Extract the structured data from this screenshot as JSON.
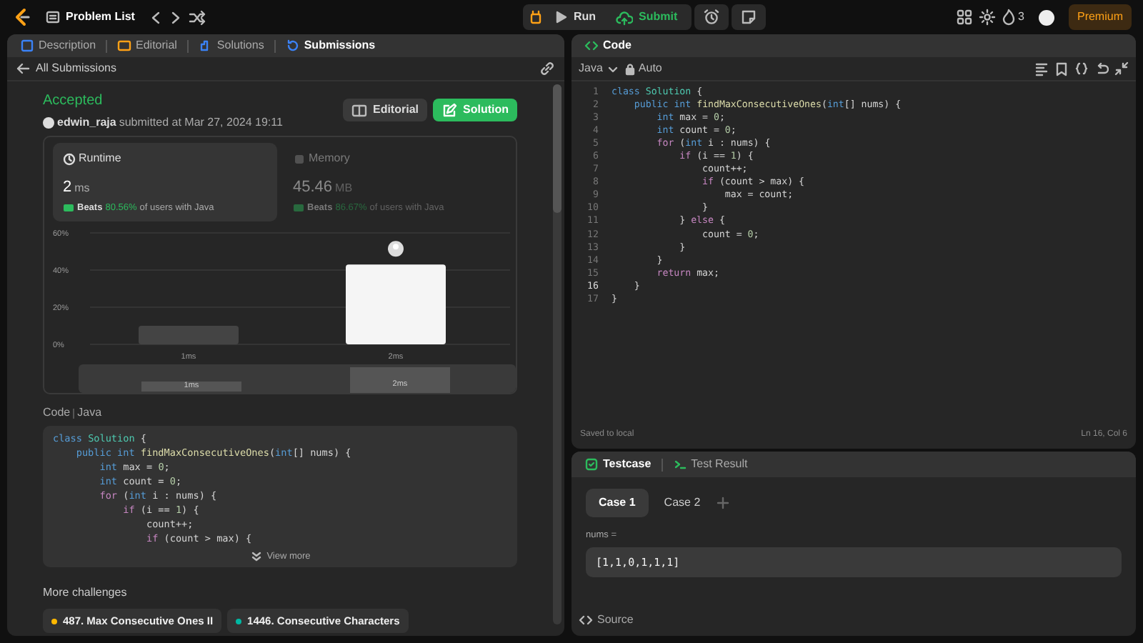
{
  "top_bar": {
    "title": "Problem List",
    "run": "Run",
    "submit": "Submit",
    "streak": "3",
    "premium": "Premium"
  },
  "left_panel": {
    "tabs": [
      {
        "label": "Description",
        "selected": false
      },
      {
        "label": "Editorial",
        "selected": false
      },
      {
        "label": "Solutions",
        "selected": false
      },
      {
        "label": "Submissions",
        "selected": true
      }
    ],
    "back_link": "All Submissions",
    "status": "Accepted",
    "user": "edwin_raja",
    "submitted": "submitted at Mar 27, 2024 19:11",
    "buttons": [
      {
        "label": "Editorial",
        "kind": "secondary"
      },
      {
        "label": "Solution",
        "kind": "primary"
      }
    ],
    "stats": [
      {
        "label": "Runtime",
        "value": "2",
        "unit": "ms",
        "beats_label": "Beats",
        "beats": "80.56%",
        "suffix": "of users with Java",
        "selected": true
      },
      {
        "label": "Memory",
        "value": "45.46",
        "unit": "MB",
        "beats_label": "Beats",
        "beats": "86.67%",
        "suffix": "of users with Java",
        "selected": false
      }
    ],
    "chart_data": {
      "type": "bar",
      "categories": [
        "1ms",
        "2ms"
      ],
      "values": [
        10,
        43
      ],
      "ylim": [
        0,
        60
      ],
      "yticks": [
        {
          "value": 0,
          "label": "0%"
        },
        {
          "value": 20,
          "label": "20%"
        },
        {
          "value": 40,
          "label": "40%"
        },
        {
          "value": 60,
          "label": "60%"
        }
      ]
    },
    "overview_labels": [
      "1ms",
      "2ms"
    ],
    "code_label": "Code",
    "code_language": "Java",
    "code_lines": [
      "class Solution {",
      "    public int findMaxConsecutiveOnes(int[] nums) {",
      "        int max = 0;",
      "        int count = 0;",
      "        for (int i : nums) {",
      "            if (i == 1) {",
      "                count++;",
      "                if (count > max) {"
    ],
    "view_more": "View more",
    "more_challenges": "More challenges",
    "challenges": [
      {
        "title": "487. Max Consecutive Ones II",
        "color": "#ffb800"
      },
      {
        "title": "1446. Consecutive Characters",
        "color": "#00b8a3"
      }
    ]
  },
  "code_panel": {
    "title": "Code",
    "language": "Java",
    "mode": "Auto",
    "lines": [
      {
        "number": "1",
        "text": "class Solution {",
        "current": false
      },
      {
        "number": "2",
        "text": "    public int findMaxConsecutiveOnes(int[] nums) {",
        "current": false
      },
      {
        "number": "3",
        "text": "        int max = 0;",
        "current": false
      },
      {
        "number": "4",
        "text": "        int count = 0;",
        "current": false
      },
      {
        "number": "5",
        "text": "        for (int i : nums) {",
        "current": false
      },
      {
        "number": "6",
        "text": "            if (i == 1) {",
        "current": false
      },
      {
        "number": "7",
        "text": "                count++;",
        "current": false
      },
      {
        "number": "8",
        "text": "                if (count > max) {",
        "current": false
      },
      {
        "number": "9",
        "text": "                    max = count;",
        "current": false
      },
      {
        "number": "10",
        "text": "                }",
        "current": false
      },
      {
        "number": "11",
        "text": "            } else {",
        "current": false
      },
      {
        "number": "12",
        "text": "                count = 0;",
        "current": false
      },
      {
        "number": "13",
        "text": "            }",
        "current": false
      },
      {
        "number": "14",
        "text": "        }",
        "current": false
      },
      {
        "number": "15",
        "text": "        return max;",
        "current": false
      },
      {
        "number": "16",
        "text": "    }",
        "current": true
      },
      {
        "number": "17",
        "text": "}",
        "current": false
      }
    ],
    "saved": "Saved to local",
    "cursor": "Ln 16, Col 6"
  },
  "test_panel": {
    "tabs": [
      {
        "label": "Testcase",
        "selected": true
      },
      {
        "label": "Test Result",
        "selected": false
      }
    ],
    "cases": [
      {
        "label": "Case 1",
        "selected": true
      },
      {
        "label": "Case 2",
        "selected": false
      }
    ],
    "input_label": "nums =",
    "input_value": "[1,1,0,1,1,1]",
    "source": "Source"
  }
}
